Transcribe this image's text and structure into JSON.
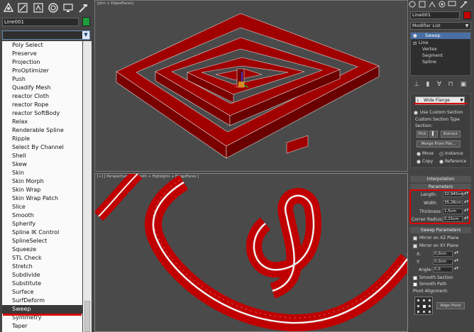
{
  "left": {
    "object_name": "Line001",
    "modifier_list": [
      "Poly Select",
      "Preserve",
      "Projection",
      "ProOptimizer",
      "Push",
      "Quadify Mesh",
      "reactor Cloth",
      "reactor Rope",
      "reactor SoftBody",
      "Relax",
      "Renderable Spline",
      "Ripple",
      "Select By Channel",
      "Shell",
      "Skew",
      "Skin",
      "Skin Morph",
      "Skin Wrap",
      "Skin Wrap Patch",
      "Slice",
      "Smooth",
      "Spherify",
      "Spline IK Control",
      "SplineSelect",
      "Squeeze",
      "STL Check",
      "Stretch",
      "Subdivide",
      "Substitute",
      "Surface",
      "SurfDeform",
      "Sweep",
      "Symmetry",
      "Taper"
    ],
    "selected_item": "Sweep",
    "accent_color": "#1c9c3c"
  },
  "viewport_top": {
    "label": "[ptm + EdgedFaces]"
  },
  "viewport_bottom": {
    "label": "[+] [ Perspective ] [ Smooth + Highlights + EdgedFaces ]"
  },
  "right": {
    "object_name": "Line001",
    "modifier_list_label": "Modifier List",
    "stack": {
      "sweep": "Sweep",
      "line": "Line",
      "vertex": "Vertex",
      "segment": "Segment",
      "spline": "Spline"
    },
    "section": {
      "dropdown_value": "Wide Flange",
      "use_custom_section": "Use Custom Section",
      "custom_section_type": "Custom Section Type",
      "section_label": "Section:",
      "pick": "Pick",
      "extract": "Extract",
      "merge_from_file": "Merge From File...",
      "move": "Move",
      "instance": "Instance",
      "copy": "Copy",
      "reference": "Reference"
    },
    "interpolation": "Interpolation",
    "parameters": {
      "title": "Parameters",
      "length_label": "Length:",
      "length": "32,945cm",
      "width_label": "Width:",
      "width": "35,28cm",
      "thickness_label": "Thickness:",
      "thickness": "1,5cm",
      "corner_label": "Corner Radius:",
      "corner": "0,15cm"
    },
    "sweep_params": {
      "title": "Sweep Parameters",
      "mirror_xz": "Mirror on XZ Plane",
      "mirror_xy": "Mirror on XY Plane",
      "x_label": "X:",
      "x": "0,0cm",
      "y_label": "Y:",
      "y": "0,0cm",
      "angle_label": "Angle:",
      "angle": "0,0",
      "smooth_section": "Smooth Section",
      "smooth_path": "Smooth Path",
      "pivot_alignment": "Pivot Alignment:",
      "align_pivot": "Align Pivot"
    },
    "highlight_color": "#e00000"
  }
}
